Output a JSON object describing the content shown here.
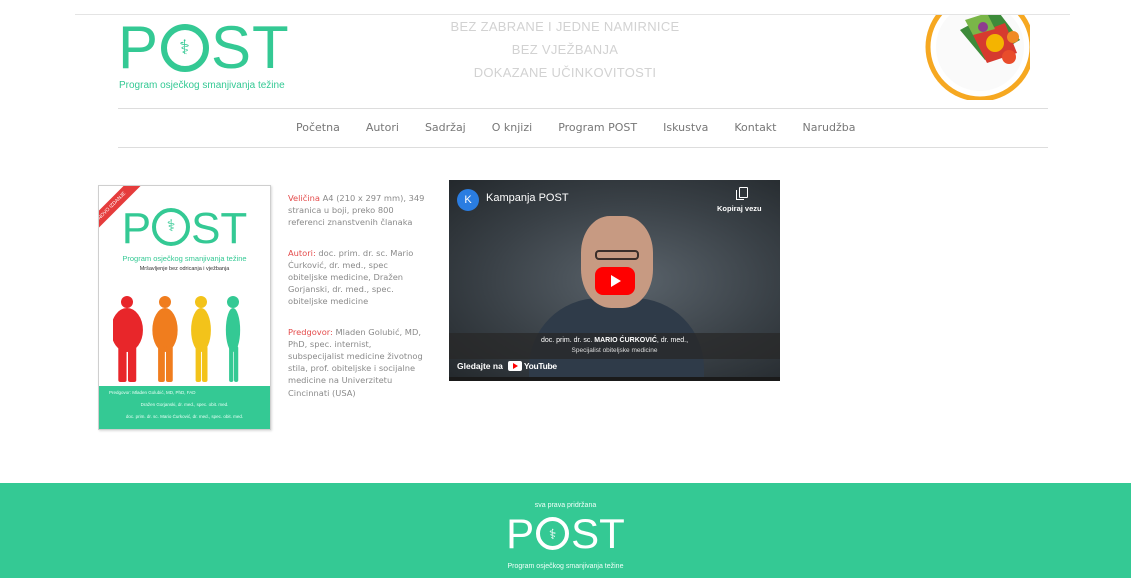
{
  "header": {
    "logo_text": "POST",
    "logo_subtitle": "Program osječkog smanjivanja težine",
    "tagline": [
      "BEZ ZABRANE I JEDNE NAMIRNICE",
      "BEZ VJEŽBANJA",
      "DOKAZANE UČINKOVITOSTI"
    ]
  },
  "nav": {
    "items": [
      "Početna",
      "Autori",
      "Sadržaj",
      "O knjizi",
      "Program POST",
      "Iskustva",
      "Kontakt",
      "Narudžba"
    ]
  },
  "book": {
    "ribbon": "NOVO IZDANJE",
    "title": "POST",
    "subtitle": "Program osječkog smanjivanja težine",
    "subtitle2": "Mršavljenje bez odricanja i vježbanja",
    "foreword_line": "Predgovor: Mladen Golubić, MD, PhD, FAD",
    "authors_lines": [
      "Dražen Gorjanski, dr. med., spec. obit. med.",
      "doc. prim. dr. sc. Mario Ćurković, dr. med., spec. obit. med."
    ],
    "figure_colors": [
      "#e8262a",
      "#f07d1e",
      "#f3c31a",
      "#34c994"
    ]
  },
  "info": {
    "size_label": "Veličina",
    "size_text": " A4 (210 x 297 mm), 349 stranica u boji, preko 800 referenci znanstvenih članaka",
    "authors_label": "Autori:",
    "authors_text": " doc. prim. dr. sc. Mario Ćurković, dr. med., spec obiteljske medicine, Dražen Gorjanski, dr. med., spec. obiteljske medicine",
    "foreword_label": "Predgovor:",
    "foreword_text": " Mladen Golubić, MD, PhD, spec. internist, subspecijalist medicine životnog stila, prof. obiteljske i socijalne medicine na Univerzitetu Cincinnati (USA)"
  },
  "video": {
    "channel_initial": "K",
    "title": "Kampanja POST",
    "copy_label": "Kopiraj vezu",
    "lower_third_prefix": "doc. prim. dr. sc. ",
    "lower_third_name": "MARIO ĆURKOVIĆ",
    "lower_third_suffix": ", dr. med.,",
    "lower_third_line2": "Specijalist obiteljske medicine",
    "watch_on": "Gledajte na",
    "youtube": "YouTube"
  },
  "footer": {
    "rights": "sva prava pridržana",
    "logo_text": "POST",
    "subtitle": "Program osječkog smanjivanja težine"
  },
  "colors": {
    "brand_green": "#34c994",
    "label_red": "#e44b4b"
  }
}
